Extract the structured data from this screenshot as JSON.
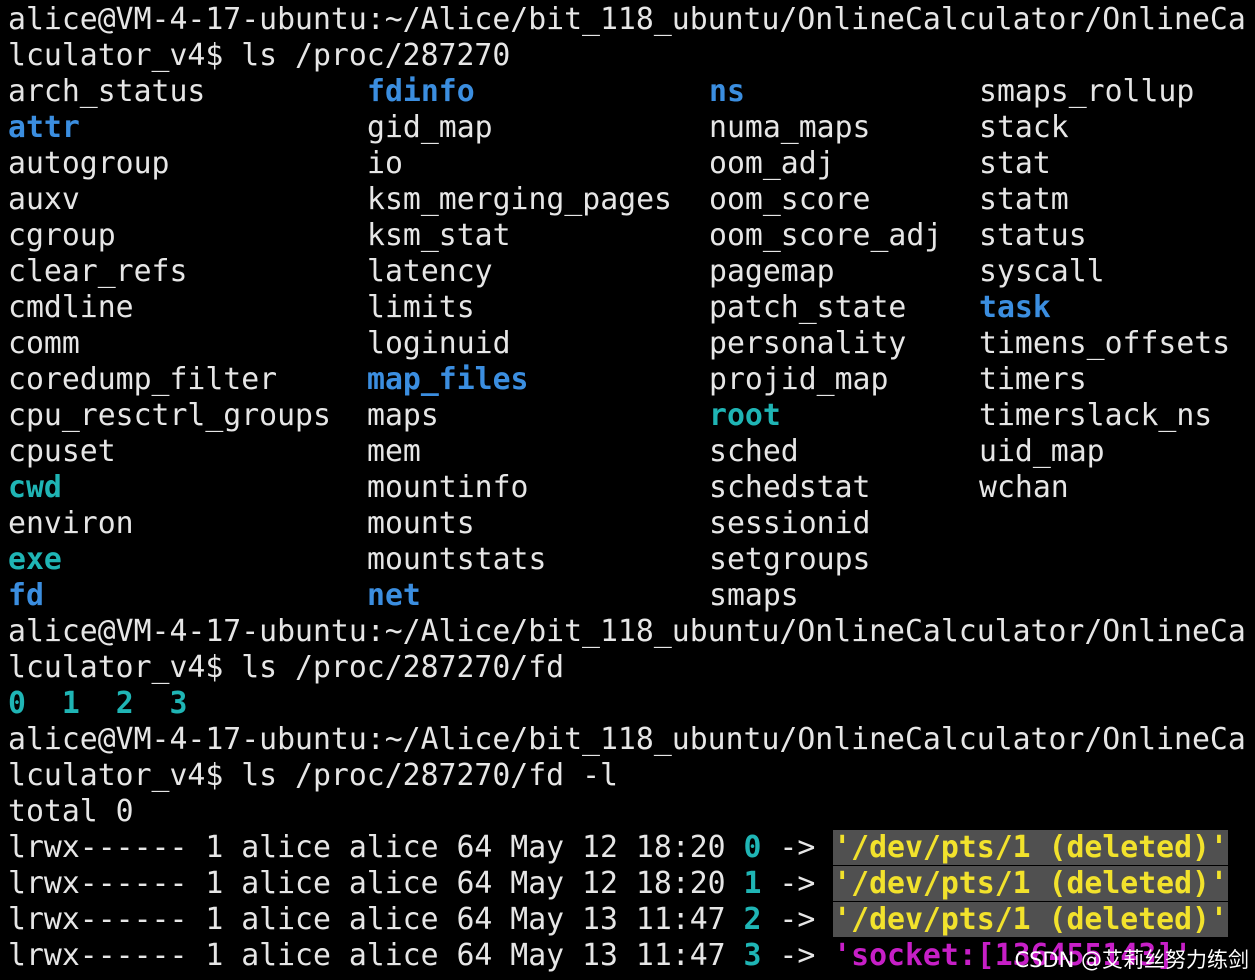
{
  "colors": {
    "background": "#000000",
    "text": "#e6e6e6",
    "directory": "#3b8ee0",
    "symlink": "#1fb5b5",
    "socket": "#c71fc7",
    "deleted_target": "#f2e22c",
    "deleted_target_bg": "#505050"
  },
  "prompt": {
    "part1": "alice@VM-4-17-ubuntu:~/Alice/bit_118_ubuntu/OnlineCalculator/OnlineCa",
    "part2_prefix": "lculator_v4$ "
  },
  "commands": {
    "ls_proc": "ls /proc/287270",
    "ls_fd": "ls /proc/287270/fd",
    "ls_fd_long": "ls /proc/287270/fd -l"
  },
  "proc_listing": {
    "col1": [
      "arch_status",
      "attr",
      "autogroup",
      "auxv",
      "cgroup",
      "clear_refs",
      "cmdline",
      "comm",
      "coredump_filter",
      "cpu_resctrl_groups",
      "cpuset",
      "cwd",
      "environ",
      "exe",
      "fd"
    ],
    "col2": [
      "fdinfo",
      "gid_map",
      "io",
      "ksm_merging_pages",
      "ksm_stat",
      "latency",
      "limits",
      "loginuid",
      "map_files",
      "maps",
      "mem",
      "mountinfo",
      "mounts",
      "mountstats",
      "net"
    ],
    "col3": [
      "ns",
      "numa_maps",
      "oom_adj",
      "oom_score",
      "oom_score_adj",
      "pagemap",
      "patch_state",
      "personality",
      "projid_map",
      "root",
      "sched",
      "schedstat",
      "sessionid",
      "setgroups",
      "smaps"
    ],
    "col4": [
      "smaps_rollup",
      "stack",
      "stat",
      "statm",
      "status",
      "syscall",
      "task",
      "timens_offsets",
      "timers",
      "timerslack_ns",
      "uid_map",
      "wchan"
    ]
  },
  "fd_listing": [
    "0",
    "1",
    "2",
    "3"
  ],
  "fd_long": {
    "total": "total 0",
    "rows": [
      {
        "perms": "lrwx------ 1 alice alice 64 May 12 18:20 ",
        "fd": "0",
        "arrow": " -> ",
        "target": "'/dev/pts/1 (deleted)'",
        "kind": "deleted"
      },
      {
        "perms": "lrwx------ 1 alice alice 64 May 12 18:20 ",
        "fd": "1",
        "arrow": " -> ",
        "target": "'/dev/pts/1 (deleted)'",
        "kind": "deleted"
      },
      {
        "perms": "lrwx------ 1 alice alice 64 May 13 11:47 ",
        "fd": "2",
        "arrow": " -> ",
        "target": "'/dev/pts/1 (deleted)'",
        "kind": "deleted"
      },
      {
        "perms": "lrwx------ 1 alice alice 64 May 13 11:47 ",
        "fd": "3",
        "arrow": " -> ",
        "target": "'socket:[136455143]'",
        "kind": "socket"
      }
    ]
  },
  "watermark": "CSDN @艾莉丝努力练剑"
}
